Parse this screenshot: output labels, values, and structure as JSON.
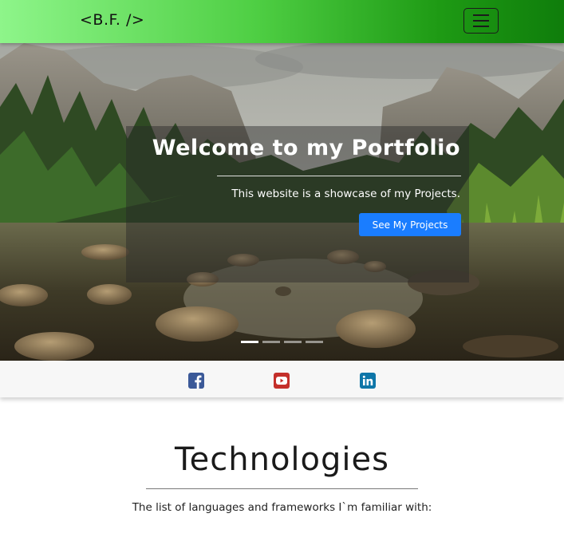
{
  "navbar": {
    "brand": "<B.F. />",
    "toggler_icon": "hamburger-icon",
    "gradient": [
      "#8ef58a",
      "#0f7d0b"
    ]
  },
  "hero": {
    "title": "Welcome to my Portfolio",
    "subtitle": "This website is a showcase of my Projects.",
    "button_label": "See My Projects",
    "button_color": "#1a7dff",
    "slide_count": 4,
    "active_slide": 1
  },
  "social": {
    "links": [
      {
        "name": "facebook-icon",
        "glyph": "f",
        "color": "#3b5998"
      },
      {
        "name": "youtube-icon",
        "glyph": "▶",
        "color": "#c4302b"
      },
      {
        "name": "linkedin-icon",
        "glyph": "in",
        "color": "#0e76a8"
      }
    ]
  },
  "technologies": {
    "title": "Technologies",
    "subtitle": "The list of languages and frameworks I`m familiar with:"
  }
}
